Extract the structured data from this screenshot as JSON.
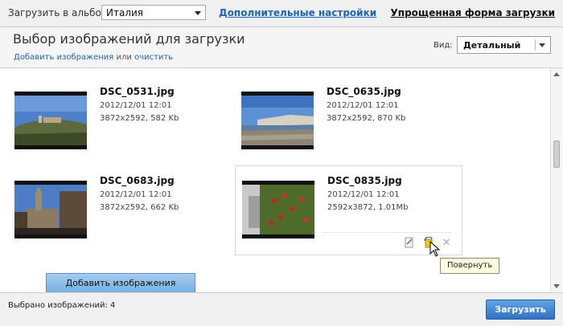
{
  "topbar": {
    "album_label": "Загрузить в альбом:",
    "album_value": "Италия",
    "extra_settings_link": "Дополнительные настройки",
    "simple_form_link": "Упрощенная форма загрузки"
  },
  "header": {
    "title": "Выбор изображений для загрузки",
    "add_link": "Добавить изображения",
    "or_text": "или",
    "clear_link": "очистить",
    "view_label": "Вид:",
    "view_value": "Детальный"
  },
  "photos": [
    {
      "name": "DSC_0531.jpg",
      "date": "2012/12/01 12:01",
      "info": "3872x2592, 582 Kb"
    },
    {
      "name": "DSC_0635.jpg",
      "date": "2012/12/01 12:01",
      "info": "3872x2592, 870 Kb"
    },
    {
      "name": "DSC_0683.jpg",
      "date": "2012/12/01 12:01",
      "info": "3872x2592, 662 Kb"
    },
    {
      "name": "DSC_0835.jpg",
      "date": "2012/12/01 12:01",
      "info": "2592x3872, 1.01Mb"
    }
  ],
  "tooltip": "Повернуть",
  "add_button": "Добавить изображения",
  "footer": {
    "selected_count": "Выбрано изображений: 4",
    "upload_button": "Загрузить"
  },
  "colors": {
    "link": "#1b64b8",
    "upload_button": "#2f72c4",
    "add_button": "#8fc0ea",
    "tooltip_bg": "#ffffe1"
  }
}
